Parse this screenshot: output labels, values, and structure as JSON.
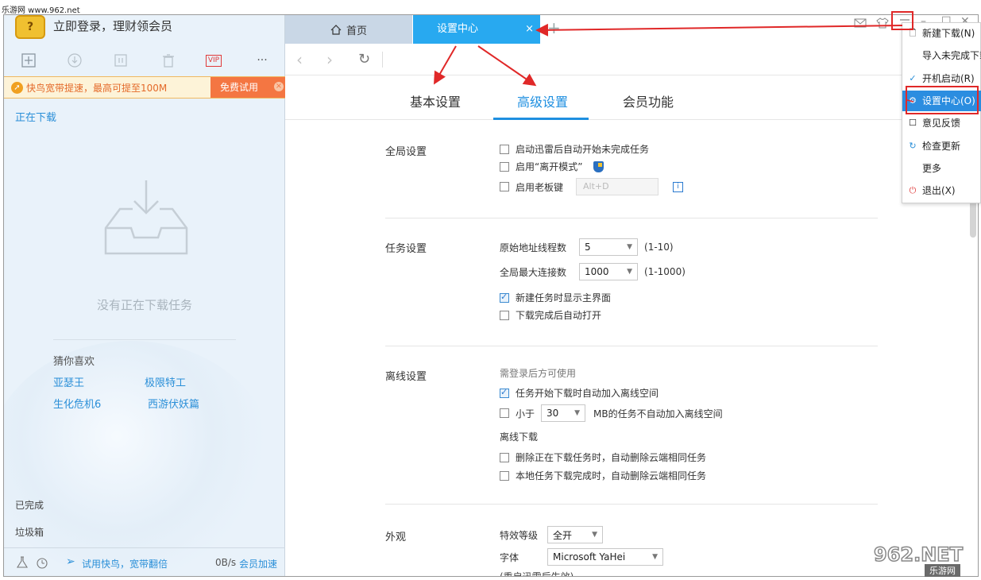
{
  "watermark_top": "乐游网 www.962.net",
  "left": {
    "avatar_glyph": "?",
    "login_text": "立即登录，理财领会员",
    "toolbar_icons": [
      "new-task-icon",
      "download-icon",
      "pause-icon",
      "delete-icon",
      "vip-icon",
      "more-icon"
    ],
    "vip_label": "VIP",
    "more_label": "···",
    "promo_text": "快鸟宽带提速，最高可提至100M",
    "promo_button": "免费试用",
    "promo_close": "×",
    "downloading_label": "正在下载",
    "empty_text": "没有正在下载任务",
    "guess_title": "猜你喜欢",
    "recommendations": [
      "亚瑟王",
      "极限特工",
      "生化危机6",
      "西游伏妖篇"
    ],
    "completed_label": "已完成",
    "trash_label": "垃圾箱",
    "bottom_promo": "试用快鸟，宽带翻倍",
    "speed": "0B/s",
    "member_accel": "会员加速"
  },
  "tabs": {
    "home": "首页",
    "settings": "设置中心",
    "close": "×",
    "add": "+"
  },
  "settings_tabs": [
    "基本设置",
    "高级设置",
    "会员功能"
  ],
  "active_settings_tab": "高级设置",
  "sections": {
    "global": {
      "title": "全局设置",
      "options": [
        {
          "label": "启动迅雷后自动开始未完成任务",
          "checked": false
        },
        {
          "label": "启用“离开模式”",
          "checked": false
        },
        {
          "label": "启用老板键",
          "checked": false
        }
      ],
      "hotkey": "Alt+D"
    },
    "task": {
      "title": "任务设置",
      "thread_label": "原始地址线程数",
      "thread_value": "5",
      "thread_range": "(1-10)",
      "conn_label": "全局最大连接数",
      "conn_value": "1000",
      "conn_range": "(1-1000)",
      "options": [
        {
          "label": "新建任务时显示主界面",
          "checked": true
        },
        {
          "label": "下载完成后自动打开",
          "checked": false
        }
      ]
    },
    "offline": {
      "title": "离线设置",
      "note": "需登录后方可使用",
      "opt1": {
        "label": "任务开始下载时自动加入离线空间",
        "checked": true
      },
      "opt2_prefix": "小于",
      "opt2_value": "30",
      "opt2_suffix": "MB的任务不自动加入离线空间",
      "opt2_checked": false,
      "subtitle": "离线下载",
      "opt3": {
        "label": "删除正在下载任务时，自动删除云端相同任务",
        "checked": false
      },
      "opt4": {
        "label": "本地任务下载完成时，自动删除云端相同任务",
        "checked": false
      }
    },
    "appearance": {
      "title": "外观",
      "effect_label": "特效等级",
      "effect_value": "全开",
      "font_label": "字体",
      "font_value": "Microsoft YaHei",
      "note": "(重启迅雷后生效)"
    }
  },
  "menu": {
    "items": [
      {
        "label": "新建下载(N)",
        "icon": "new-file-icon",
        "glyph": "🗋"
      },
      {
        "label": "导入未完成下载",
        "icon": "",
        "glyph": ""
      },
      {
        "label": "开机启动(R)",
        "icon": "check-icon",
        "glyph": "✓"
      },
      {
        "label": "设置中心(O)",
        "icon": "settings-icon",
        "glyph": "⚙"
      },
      {
        "label": "意见反馈",
        "icon": "feedback-icon",
        "glyph": "☐"
      },
      {
        "label": "检查更新",
        "icon": "refresh-icon",
        "glyph": "↻"
      },
      {
        "label": "更多",
        "icon": "",
        "glyph": ""
      },
      {
        "label": "退出(X)",
        "icon": "power-icon",
        "glyph": "⏻"
      }
    ],
    "selected_index": 3
  },
  "logo_text": "962.NET",
  "logo_sub": "乐游网",
  "colors": {
    "accent": "#28a9f0",
    "link": "#2a8fd8",
    "promo": "#f47642",
    "annotation": "#e02828"
  }
}
